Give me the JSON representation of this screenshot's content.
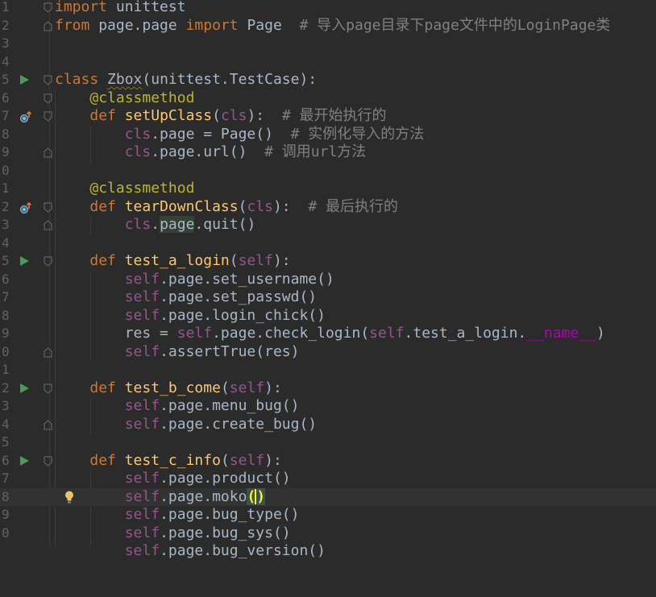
{
  "editor": {
    "line_numbers": [
      "1",
      "2",
      "3",
      "4",
      "5",
      "6",
      "7",
      "8",
      "9",
      "0",
      "1",
      "2",
      "3",
      "4",
      "5",
      "6",
      "7",
      "8",
      "9",
      "0",
      "1",
      "2",
      "3",
      "4",
      "5",
      "6",
      "7",
      "8",
      "9",
      "0"
    ],
    "code": {
      "l1_kw": "import",
      "l1_rest": " unittest",
      "l2_kw1": "from",
      "l2_mid": " page.page ",
      "l2_kw2": "import",
      "l2_rest": " Page  ",
      "l2_comment": "# 导入page目录下page文件中的LoginPage类",
      "l5_kw": "class",
      "l5_name": "Zbox",
      "l5_rest": "(unittest.TestCase):",
      "l6_dec": "@classmethod",
      "l7_kw": "def",
      "l7_fn": "setUpClass",
      "l7_p1": "(",
      "l7_self": "cls",
      "l7_p2": "):  ",
      "l7_comment": "# 最开始执行的",
      "l8_self": "cls",
      "l8_rest": ".page = Page()  ",
      "l8_comment": "# 实例化导入的方法",
      "l9_self": "cls",
      "l9_rest": ".page.url()  ",
      "l9_comment": "# 调用url方法",
      "l11_dec": "@classmethod",
      "l12_kw": "def",
      "l12_fn": "tearDownClass",
      "l12_p1": "(",
      "l12_self": "cls",
      "l12_p2": "):  ",
      "l12_comment": "# 最后执行的",
      "l13_self": "cls",
      "l13_dot": ".",
      "l13_page": "page",
      "l13_rest": ".quit()",
      "l15_kw": "def",
      "l15_fn": "test_a_login",
      "l15_p1": "(",
      "l15_self": "self",
      "l15_p2": "):",
      "l16_self": "self",
      "l16_rest": ".page.set_username()",
      "l17_self": "self",
      "l17_rest": ".page.set_passwd()",
      "l18_self": "self",
      "l18_rest": ".page.login_chick()",
      "l19_a": "res = ",
      "l19_self1": "self",
      "l19_b": ".page.check_login(",
      "l19_self2": "self",
      "l19_c": ".test_a_login.",
      "l19_dunder": "__name__",
      "l19_d": ")",
      "l20_self": "self",
      "l20_rest": ".assertTrue(res)",
      "l22_kw": "def",
      "l22_fn": "test_b_come",
      "l22_p1": "(",
      "l22_self": "self",
      "l22_p2": "):",
      "l23_self": "self",
      "l23_rest": ".page.menu_bug()",
      "l24_self": "self",
      "l24_rest": ".page.create_bug()",
      "l26_kw": "def",
      "l26_fn": "test_c_info",
      "l26_p1": "(",
      "l26_self": "self",
      "l26_p2": "):",
      "l27_self": "self",
      "l27_rest": ".page.product()",
      "l28_self": "self",
      "l28_rest": ".page.moko",
      "l28_open": "(",
      "l28_close": ")",
      "l29_self": "self",
      "l29_rest": ".page.bug_type()",
      "l30_self": "self",
      "l30_rest": ".page.bug_sys()",
      "l31_self": "self",
      "l31_rest": ".page.bug_version()"
    }
  },
  "colors": {
    "background": "#2b2b2b",
    "keyword": "#cc7832",
    "function": "#ffc66d",
    "self": "#94558d",
    "comment": "#808080",
    "decorator": "#bbb529",
    "run_icon": "#499c54"
  },
  "icons": {
    "run": "run-test-triangle-icon",
    "override": "overrides-method-icon",
    "fold": "fold-marker-icon",
    "intention": "lightbulb-icon"
  }
}
